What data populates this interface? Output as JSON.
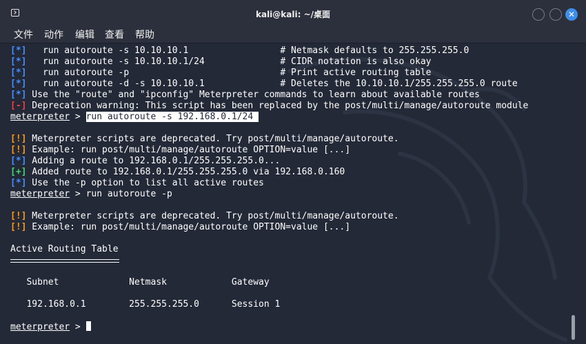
{
  "window": {
    "title": "kali@kali: ~/桌面",
    "close_glyph": "✕"
  },
  "menu": [
    "文件",
    "动作",
    "编辑",
    "查看",
    "帮助"
  ],
  "colors": {
    "info": "#4c8ef5",
    "error": "#e8434a",
    "warning": "#f39c26",
    "success": "#4fd07a",
    "background": "#232937"
  },
  "terminal": {
    "l1": {
      "tag": "[*]",
      "text": "   run autoroute -s 10.10.10.1                 # Netmask defaults to 255.255.255.0"
    },
    "l2": {
      "tag": "[*]",
      "text": "   run autoroute -s 10.10.10.1/24              # CIDR notation is also okay"
    },
    "l3": {
      "tag": "[*]",
      "text": "   run autoroute -p                            # Print active routing table"
    },
    "l4": {
      "tag": "[*]",
      "text": "   run autoroute -d -s 10.10.10.1              # Deletes the 10.10.10.1/255.255.255.0 route"
    },
    "l5": {
      "tag": "[*]",
      "text": " Use the \"route\" and \"ipconfig\" Meterpreter commands to learn about available routes"
    },
    "l6": {
      "tag": "[-]",
      "text": " Deprecation warning: This script has been replaced by the post/multi/manage/autoroute module"
    },
    "p1": {
      "prompt": "meterpreter",
      "sep": " > ",
      "cmd": "run autoroute -s 192.168.0.1/24 "
    },
    "l7": {
      "tag": "[!]",
      "text": " Meterpreter scripts are deprecated. Try post/multi/manage/autoroute."
    },
    "l8": {
      "tag": "[!]",
      "text": " Example: run post/multi/manage/autoroute OPTION=value [...]"
    },
    "l9": {
      "tag": "[*]",
      "text": " Adding a route to 192.168.0.1/255.255.255.0..."
    },
    "l10": {
      "tag": "[+]",
      "text": " Added route to 192.168.0.1/255.255.255.0 via 192.168.0.160"
    },
    "l11": {
      "tag": "[*]",
      "text": " Use the -p option to list all active routes"
    },
    "p2": {
      "prompt": "meterpreter",
      "sep": " > ",
      "cmd": "run autoroute -p"
    },
    "l12": {
      "tag": "[!]",
      "text": " Meterpreter scripts are deprecated. Try post/multi/manage/autoroute."
    },
    "l13": {
      "tag": "[!]",
      "text": " Example: run post/multi/manage/autoroute OPTION=value [...]"
    },
    "table_title": "Active Routing Table",
    "table_header": "   Subnet             Netmask            Gateway",
    "table_row": "   192.168.0.1        255.255.255.0      Session 1",
    "p3": {
      "prompt": "meterpreter",
      "sep": " > "
    }
  }
}
